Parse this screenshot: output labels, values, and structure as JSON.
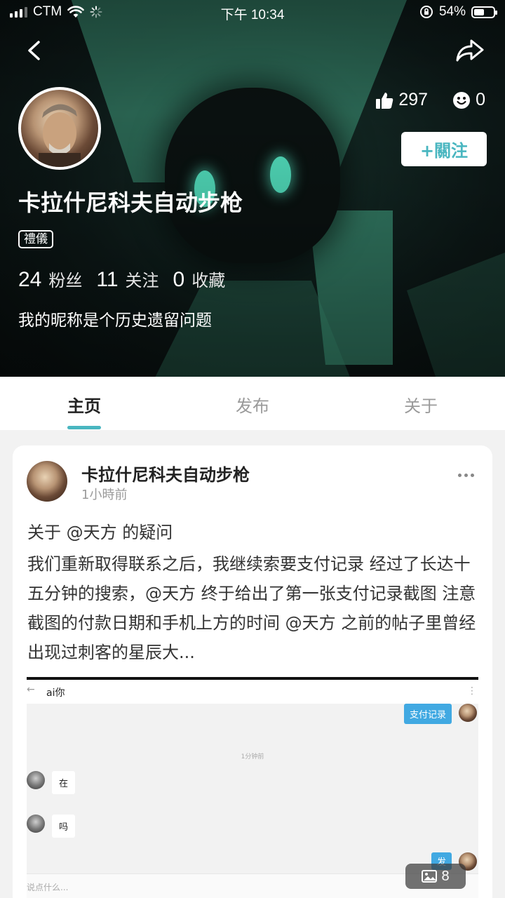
{
  "status_bar": {
    "carrier": "CTM",
    "time": "下午 10:34",
    "battery": "54%",
    "battery_level": 0.54
  },
  "profile": {
    "likes": "297",
    "reactions": "0",
    "follow_label": "+關注",
    "nickname": "卡拉什尼科夫自动步枪",
    "tag": "禮儀",
    "followers_count": "24",
    "followers_label": "粉丝",
    "following_count": "11",
    "following_label": "关注",
    "favorites_count": "0",
    "favorites_label": "收藏",
    "bio": "我的昵称是个历史遗留问题"
  },
  "tabs": [
    {
      "label": "主页",
      "active": true
    },
    {
      "label": "发布",
      "active": false
    },
    {
      "label": "关于",
      "active": false
    }
  ],
  "post": {
    "author": "卡拉什尼科夫自动步枪",
    "time": "1小時前",
    "title": "关于 @天方 的疑问",
    "body": "我们重新取得联系之后，我继续索要支付记录 经过了长达十五分钟的搜索，@天方 终于给出了第一张支付记录截图  注意截图的付款日期和手机上方的时间 @天方 之前的帖子里曾经出现过刺客的星辰大...",
    "image_count": "8",
    "screenshot": {
      "chat_title": "ai你",
      "out_message_1": "支付记录",
      "timestamp": "1分钟前",
      "in_message_1": "在",
      "in_message_2": "吗",
      "out_message_2": "发",
      "input_placeholder": "说点什么..."
    }
  },
  "colors": {
    "accent": "#49b6c0",
    "chat_blue": "#41a9e2",
    "hero_green": "#3f9a7c"
  }
}
